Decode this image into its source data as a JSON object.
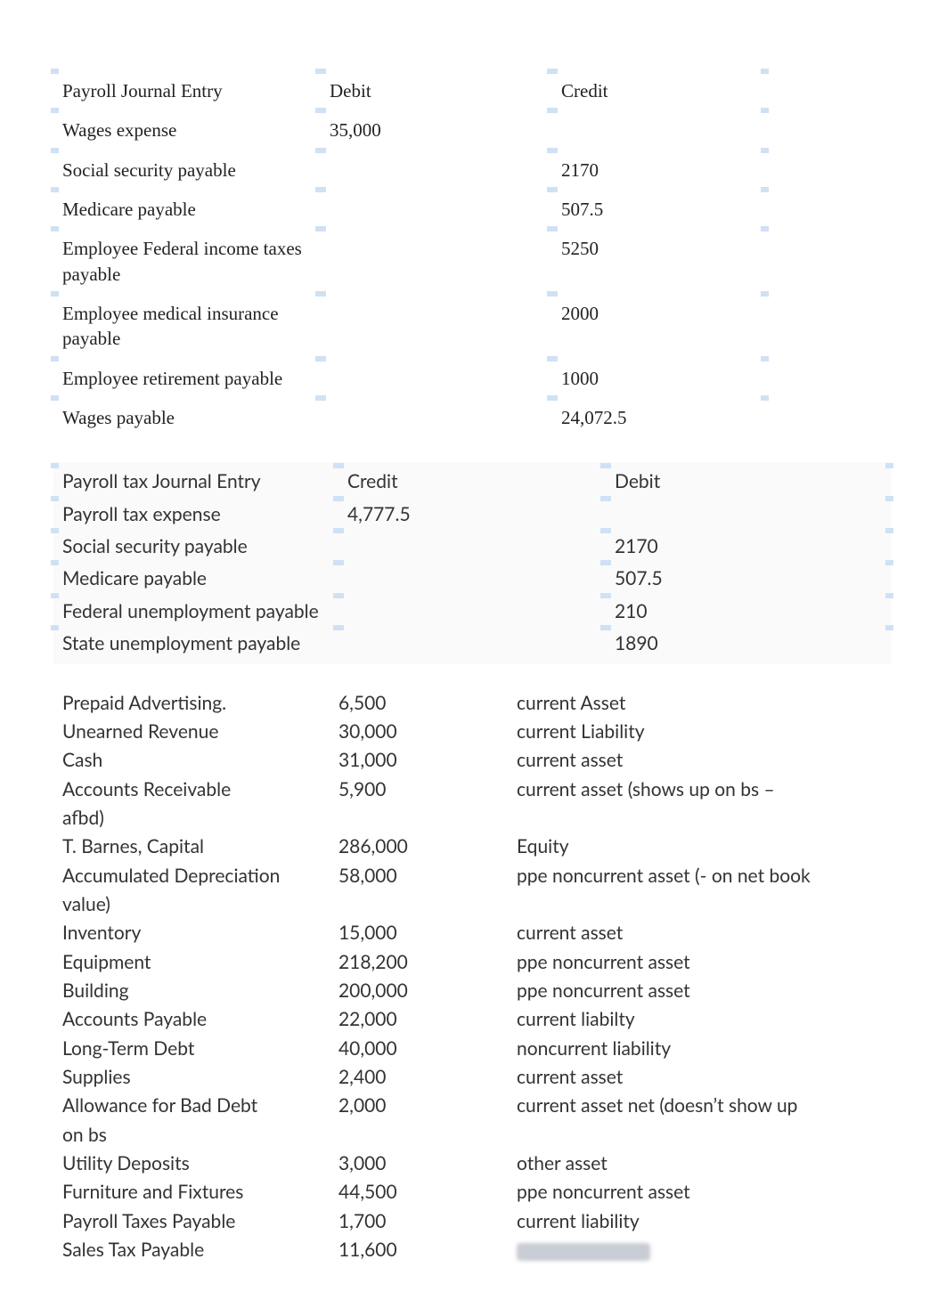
{
  "table1": {
    "headers": {
      "label": "Payroll Journal Entry",
      "debit": "Debit",
      "credit": "Credit"
    },
    "rows": [
      {
        "label": "Wages expense",
        "debit": "35,000",
        "credit": ""
      },
      {
        "label": "Social security payable",
        "debit": "",
        "credit": "2170"
      },
      {
        "label": "Medicare payable",
        "debit": "",
        "credit": "507.5"
      },
      {
        "label": "Employee Federal income taxes payable",
        "debit": "",
        "credit": "5250"
      },
      {
        "label": "Employee medical insurance payable",
        "debit": "",
        "credit": "2000"
      },
      {
        "label": "Employee retirement payable",
        "debit": "",
        "credit": "1000"
      },
      {
        "label": "Wages payable",
        "debit": "",
        "credit": "24,072.5"
      }
    ]
  },
  "table2": {
    "headers": {
      "label": "Payroll tax Journal Entry",
      "debit": "Credit",
      "credit": "Debit"
    },
    "rows": [
      {
        "label": "Payroll tax expense",
        "debit": "4,777.5",
        "credit": ""
      },
      {
        "label": "Social security payable",
        "debit": "",
        "credit": "2170"
      },
      {
        "label": "Medicare payable",
        "debit": "",
        "credit": "507.5"
      },
      {
        "label": "Federal unemployment payable",
        "debit": "",
        "credit": "210"
      },
      {
        "label": "State unemployment payable",
        "debit": "",
        "credit": "1890"
      }
    ]
  },
  "accounts": [
    {
      "name": "Prepaid Advertising.",
      "amount": "6,500",
      "class": "current Asset"
    },
    {
      "name": "Unearned Revenue",
      "amount": "30,000",
      "class": "current Liability"
    },
    {
      "name": "Cash",
      "amount": "31,000",
      "class": "current asset"
    },
    {
      "name": "Accounts Receivable",
      "amount": "5,900",
      "class": "current asset (shows up on bs – afbd)",
      "wrap_suffix": true
    },
    {
      "name": "T. Barnes, Capital",
      "amount": "286,000",
      "class": "Equity"
    },
    {
      "name": "Accumulated Depreciation",
      "amount": "58,000",
      "class": "ppe noncurrent asset (- on net book value)",
      "wrap_suffix": true
    },
    {
      "name": "Inventory",
      "amount": "15,000",
      "class": "current asset"
    },
    {
      "name": "Equipment",
      "amount": "218,200",
      "class": "ppe noncurrent asset"
    },
    {
      "name": "Building",
      "amount": "200,000",
      "class": "ppe noncurrent asset"
    },
    {
      "name": "Accounts Payable",
      "amount": "22,000",
      "class": "current liabilty"
    },
    {
      "name": "Long-Term Debt",
      "amount": "40,000",
      "class": "noncurrent liability"
    },
    {
      "name": "Supplies",
      "amount": "2,400",
      "class": "current asset"
    },
    {
      "name": "Allowance for Bad Debt",
      "amount": "2,000",
      "class": "current asset net (doesn’t show up on bs",
      "wrap_suffix": true
    },
    {
      "name": "Utility Deposits",
      "amount": "3,000",
      "class": "other asset"
    },
    {
      "name": "Furniture and Fixtures",
      "amount": "44,500",
      "class": "ppe noncurrent asset"
    },
    {
      "name": "Payroll Taxes Payable",
      "amount": "1,700",
      "class": "current liability"
    },
    {
      "name": "Sales Tax Payable",
      "amount": "11,600",
      "class": "__BLUR__"
    }
  ],
  "chart_data": {
    "type": "table",
    "tables": [
      {
        "title": "Payroll Journal Entry",
        "columns": [
          "Account",
          "Debit",
          "Credit"
        ],
        "rows": [
          [
            "Wages expense",
            35000,
            null
          ],
          [
            "Social security payable",
            null,
            2170
          ],
          [
            "Medicare payable",
            null,
            507.5
          ],
          [
            "Employee Federal income taxes payable",
            null,
            5250
          ],
          [
            "Employee medical insurance payable",
            null,
            2000
          ],
          [
            "Employee retirement payable",
            null,
            1000
          ],
          [
            "Wages payable",
            null,
            24072.5
          ]
        ]
      },
      {
        "title": "Payroll tax Journal Entry",
        "columns": [
          "Account",
          "Credit",
          "Debit"
        ],
        "rows": [
          [
            "Payroll tax expense",
            4777.5,
            null
          ],
          [
            "Social security payable",
            null,
            2170
          ],
          [
            "Medicare payable",
            null,
            507.5
          ],
          [
            "Federal unemployment payable",
            null,
            210
          ],
          [
            "State unemployment payable",
            null,
            1890
          ]
        ]
      },
      {
        "title": "Account Classifications",
        "columns": [
          "Account",
          "Amount",
          "Classification"
        ],
        "rows": [
          [
            "Prepaid Advertising.",
            6500,
            "current Asset"
          ],
          [
            "Unearned Revenue",
            30000,
            "current Liability"
          ],
          [
            "Cash",
            31000,
            "current asset"
          ],
          [
            "Accounts Receivable",
            5900,
            "current asset (shows up on bs – afbd)"
          ],
          [
            "T. Barnes, Capital",
            286000,
            "Equity"
          ],
          [
            "Accumulated Depreciation",
            58000,
            "ppe noncurrent asset (- on net book value)"
          ],
          [
            "Inventory",
            15000,
            "current asset"
          ],
          [
            "Equipment",
            218200,
            "ppe noncurrent asset"
          ],
          [
            "Building",
            200000,
            "ppe noncurrent asset"
          ],
          [
            "Accounts Payable",
            22000,
            "current liabilty"
          ],
          [
            "Long-Term Debt",
            40000,
            "noncurrent liability"
          ],
          [
            "Supplies",
            2400,
            "current asset"
          ],
          [
            "Allowance for Bad Debt",
            2000,
            "current asset net (doesn’t show up on bs"
          ],
          [
            "Utility Deposits",
            3000,
            "other asset"
          ],
          [
            "Furniture and Fixtures",
            44500,
            "ppe noncurrent asset"
          ],
          [
            "Payroll Taxes Payable",
            1700,
            "current liability"
          ],
          [
            "Sales Tax Payable",
            11600,
            null
          ]
        ]
      }
    ]
  }
}
